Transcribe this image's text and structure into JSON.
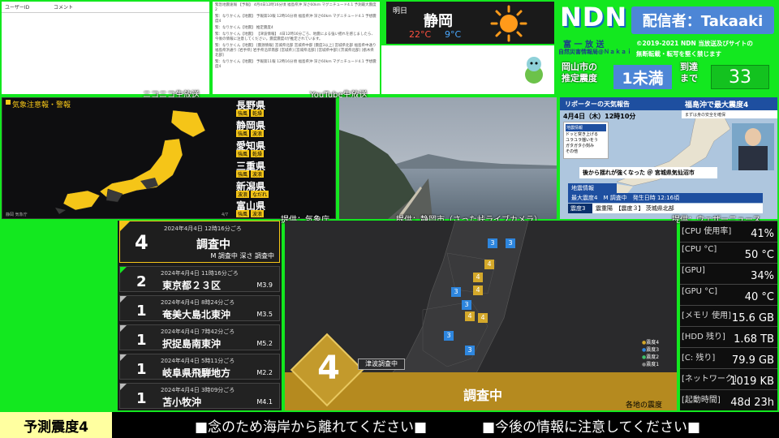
{
  "comments": {
    "col1": "ユーザーID",
    "col2": "コメント"
  },
  "youtube_comments": [
    "緊急地震速報 【予報】 4月4日12時16分頃 福島県沖 深さ60km マグニチュード4.1 予測最大震度2",
    "緊：なりかくん【地震】 予報第10報 12時16分頃 福島県沖 深さ60km マグニチュード4.1 予想震度4",
    "緊：なりかくん【地震】 推定震度4",
    "緊：なりかくん【地震】 【津波情報】 4日12時16分ごろ、地震による強い揺れを感じましたら、今後の情報に注意してください。震度震度4が推定されています。",
    "緊：なりかくん【地震】 [震源情報] 宮城県北部 宮城県中部 [震度3以上] 宮城県北部 福島県中通り 福島県浜通り [岩手県] 岩手県沿岸南部 [宮城県] [宮城県北部] [宮城県中部] [茨城県北部] [栃木県北部]",
    "緊：なりかくん【地震】 予報第11報 12時16分頃 福島県沖 深さ60km マグニチュード4.1 予想震度4"
  ],
  "captions": {
    "niconico": "ニコニコ生放送",
    "youtube": "YouTube生放送",
    "jma": "提供：気象庁",
    "shizuoka": "提供：静岡市（さった峠ライブカメラ）",
    "weathernews": "提供：ウェザーニュース"
  },
  "weather": {
    "label": "明日",
    "city": "静岡",
    "high": "22°C",
    "low": "9°C",
    "icon": "sun-icon"
  },
  "ndn": {
    "logo": "NDN",
    "broadcaster": "配信者：Takaaki",
    "sub1": "富 一 放 送",
    "sub2": "自然災害情報局@Ｎａｋａｉ",
    "copyright1": "©2019-2021 NDN 当放送及びサイトの",
    "copyright2": "無断転載・転写を堅く禁じます",
    "est_label1": "岡山市の",
    "est_label2": "推定震度",
    "est_value": "1未満",
    "arrival_label1": "到達",
    "arrival_label2": "まで",
    "arrival_value": "33"
  },
  "alert_map": {
    "title": "気象注意報・警報",
    "footer_left": "静岡 気象庁",
    "footer_right": "4/7",
    "prefectures": [
      {
        "name": "長野県",
        "tags": [
          "強風",
          "乾燥"
        ]
      },
      {
        "name": "静岡県",
        "tags": [
          "強風",
          "波浪"
        ]
      },
      {
        "name": "愛知県",
        "tags": [
          "強風",
          "乾燥"
        ]
      },
      {
        "name": "三重県",
        "tags": [
          "強風",
          "波浪"
        ]
      },
      {
        "name": "新潟県",
        "tags": [
          "波浪",
          "なだれ"
        ]
      },
      {
        "name": "富山県",
        "tags": [
          "強風",
          "波浪"
        ]
      }
    ]
  },
  "news": {
    "header": "リポーターの天気報告",
    "headline": "福島沖で最大震度4",
    "subhead": "まずは身の安全を確保",
    "datetime": "4月4日（木）12時10分",
    "legend_title": "地震情報",
    "legend": [
      "ドッと突き上げる",
      "ユラユラ揺いをう",
      "ガタガタ小刻み",
      "その他"
    ],
    "report": "後から揺れが強くなった ＠ 宮城県気仙沼市",
    "bar_title": "地震情報",
    "bar1": "最大震度4　M 調査中　発生日時 12:16頃",
    "bar2": "震度3",
    "bar3": "震重陽",
    "bar4": "【震度３】 茨城県北部"
  },
  "eq_current": {
    "datetime": "2024年4月4日 12時16分ごろ",
    "intensity": "4",
    "status": "調査中",
    "details": "M 調査中 深さ 調査中"
  },
  "eq_history": [
    {
      "datetime": "2024年4月4日 11時16分ごろ",
      "intensity": "2",
      "place": "東京都２３区",
      "mag": "M3.9"
    },
    {
      "datetime": "2024年4月4日 8時24分ごろ",
      "intensity": "1",
      "place": "奄美大島北東沖",
      "mag": "M3.5"
    },
    {
      "datetime": "2024年4月4日 7時42分ごろ",
      "intensity": "1",
      "place": "択捉島南東沖",
      "mag": "M5.2"
    },
    {
      "datetime": "2024年4月4日 5時11分ごろ",
      "intensity": "1",
      "place": "岐阜県飛騨地方",
      "mag": "M2.2"
    },
    {
      "datetime": "2024年4月4日 3時09分ごろ",
      "intensity": "1",
      "place": "苫小牧沖",
      "mag": "M4.1"
    }
  ],
  "eq_map": {
    "big_intensity": "4",
    "tsunami": "津波調査中",
    "status": "調査中",
    "footer": "各地の震度",
    "legend": [
      "震度4",
      "震度3",
      "震度2",
      "震度1"
    ],
    "markers": [
      "3",
      "3",
      "4",
      "4",
      "3",
      "4",
      "3",
      "4",
      "4",
      "3",
      "3"
    ]
  },
  "pc": [
    {
      "label": "[CPU 使用率]",
      "value": "41%"
    },
    {
      "label": "[CPU °C]",
      "value": "50 °C"
    },
    {
      "label": "[GPU]",
      "value": "34%"
    },
    {
      "label": "[GPU °C]",
      "value": "40 °C"
    },
    {
      "label": "[メモリ 使用]",
      "value": "15.6 GB"
    },
    {
      "label": "[HDD 残り]",
      "value": "1.68 TB"
    },
    {
      "label": "[C: 残り]",
      "value": "79.9 GB"
    },
    {
      "label": "[ネットワーク]",
      "value": "1019 KB"
    },
    {
      "label": "[起動時間]",
      "value": "48d 23h"
    }
  ],
  "bottom": {
    "predicted": "予測震度4",
    "msg1": "■念のため海岸から離れてください■",
    "msg2": "■今後の情報に注意してください■"
  },
  "colors": {
    "accent": "#13e81f",
    "alert": "#f5c518",
    "news_blue": "#1e4fa0",
    "intensity4": "#d4a82a"
  }
}
